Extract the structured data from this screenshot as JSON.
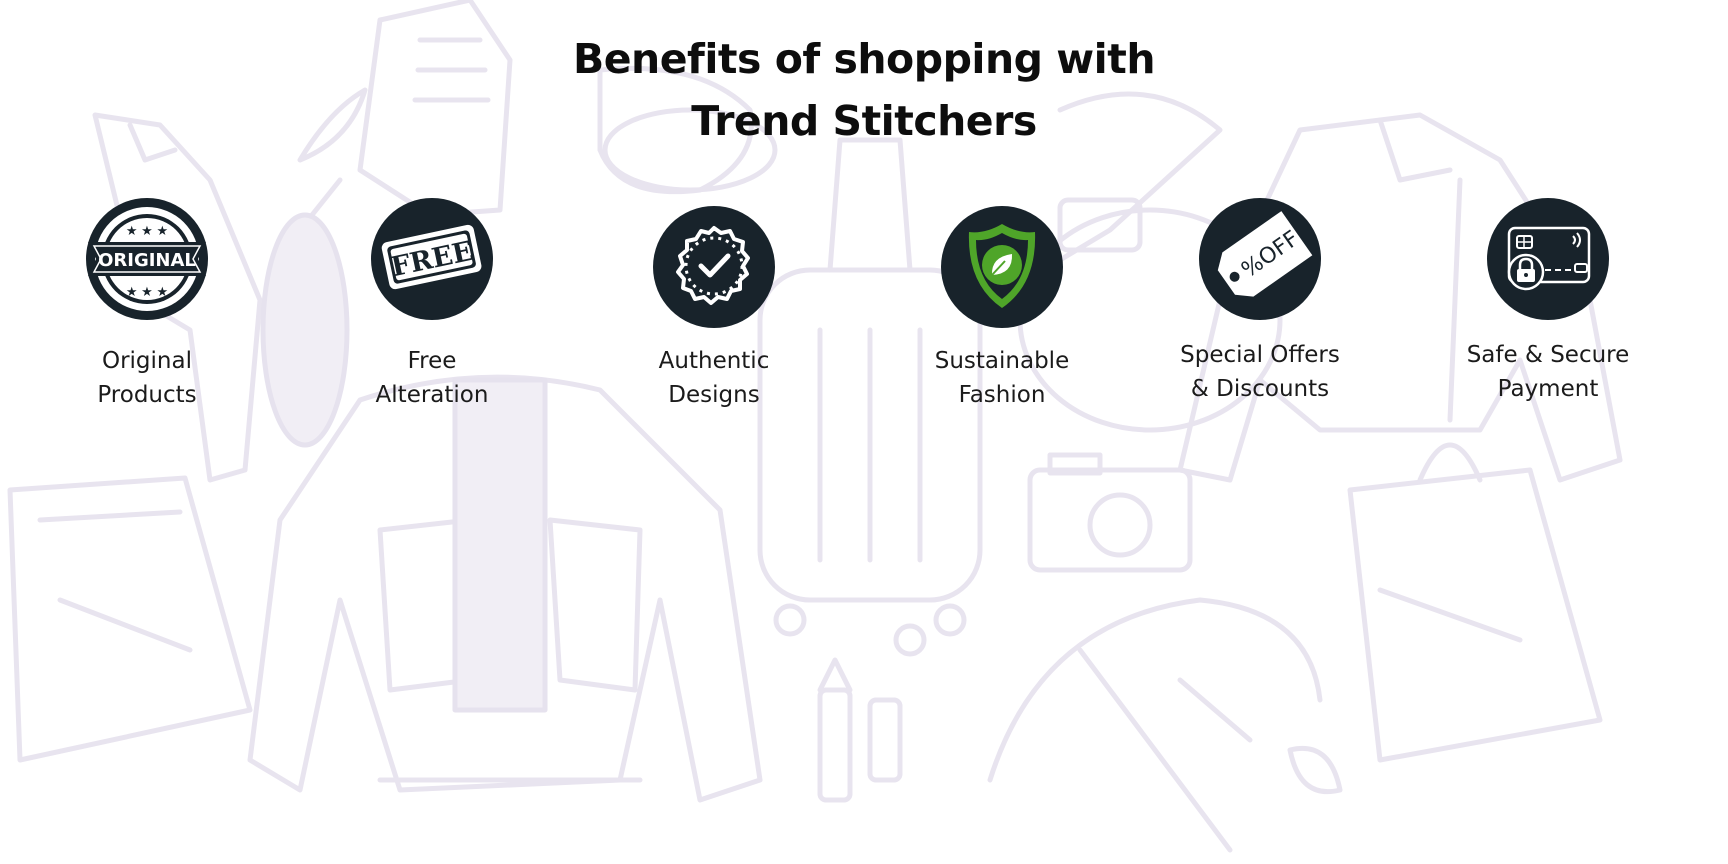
{
  "heading": {
    "line1": "Benefits of shopping with",
    "line2": "Trend Stitchers"
  },
  "benefits": [
    {
      "icon": "original-stamp-icon",
      "badge_text": "ORIGINAL",
      "label_line1": "Original",
      "label_line2": "Products"
    },
    {
      "icon": "free-stamp-icon",
      "badge_text": "FREE",
      "label_line1": "Free",
      "label_line2": "Alteration"
    },
    {
      "icon": "verified-checkmark-icon",
      "label_line1": "Authentic",
      "label_line2": "Designs"
    },
    {
      "icon": "leaf-shield-icon",
      "label_line1": "Sustainable",
      "label_line2": "Fashion"
    },
    {
      "icon": "price-tag-icon",
      "badge_text": "%OFF",
      "label_line1": "Special Offers",
      "label_line2": "& Discounts"
    },
    {
      "icon": "secure-card-icon",
      "label_line1": "Safe & Secure",
      "label_line2": "Payment"
    }
  ],
  "colors": {
    "badge": "#18232b",
    "leaf_green": "#4fa529",
    "background_art": "#e8e4ef"
  }
}
